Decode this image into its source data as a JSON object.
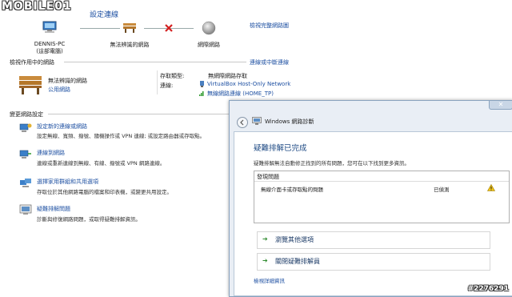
{
  "watermark": {
    "logo": "MOBILE01",
    "post_id": "#2276291"
  },
  "header": {
    "title": "設定連線",
    "view_full_map": "檢視完整網路圖"
  },
  "network_map": {
    "computer_name": "DENNIS-PC",
    "computer_sub": "(這部電腦)",
    "unidentified_network": "無法辨識的網路",
    "internet": "網際網路"
  },
  "active_networks": {
    "header": "檢視作用中的網路",
    "connect_disconnect": "連線或中斷連線",
    "network_name": "無法辨識的網路",
    "network_type": "公用網路",
    "access_type_label": "存取類型:",
    "access_type_value": "無網際網路存取",
    "connections_label": "連線:",
    "connection_1": "VirtualBox Host-Only Network",
    "connection_2": "無線網路連線 (HOME_TP)"
  },
  "change_settings": {
    "header": "變更網路設定",
    "tasks": [
      {
        "title": "設定新的連線或網路",
        "desc_1": "設定無線、寬頻、撥號、隨機操作或 VPN 連線; 或設定路由器或存取點。",
        "desc_2": ""
      },
      {
        "title": "連線到網路",
        "desc_1": "連線或重新連線到無線、有線、撥號或 VPN 網路連線。",
        "desc_2": ""
      },
      {
        "title": "選擇家用群組和共用選項",
        "desc_1": "存取位於其他網路電腦的檔案和印表機，或變更共用設定。",
        "desc_2": ""
      },
      {
        "title": "疑難排解問題",
        "desc_1": "診斷與修復網路問題，或取得疑難排解資訊。",
        "desc_2": ""
      }
    ]
  },
  "dialog": {
    "title": "Windows 網路診斷",
    "heading": "疑難排解已完成",
    "description": "疑難排解無法自動修正找到的所有問題，您可在以下找到更多資訊。",
    "list_header": "發現問題",
    "problem_text": "無線介面卡或存取點的問題",
    "problem_status": "已偵測",
    "action_1": "瀏覽其他選項",
    "action_2": "關閉疑難排解員",
    "detail_link": "檢視詳細資訊"
  }
}
